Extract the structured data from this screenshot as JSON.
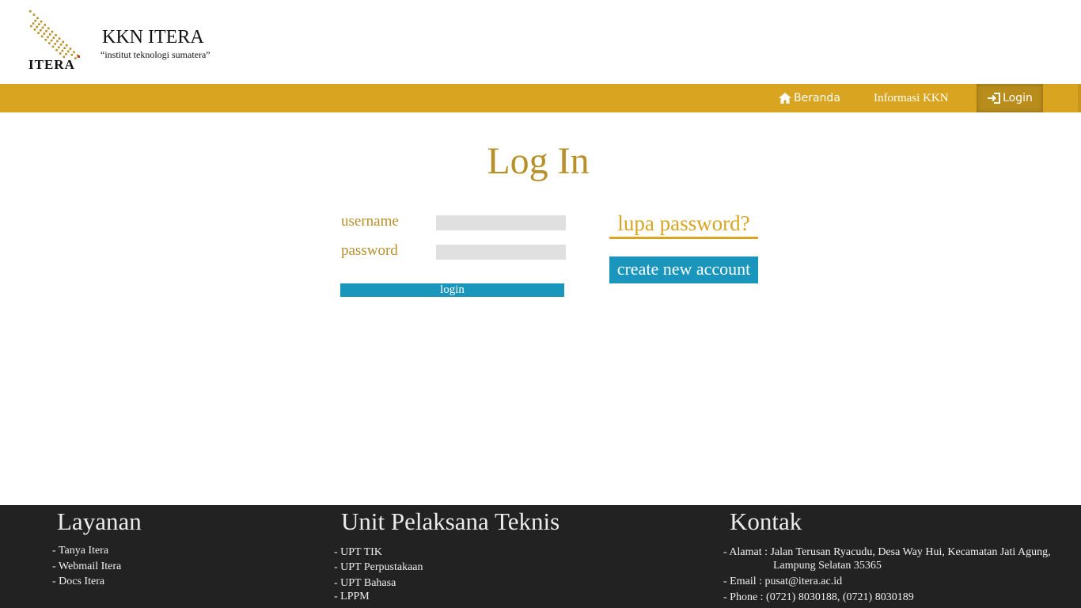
{
  "header": {
    "logo_text": "ITERA",
    "site_title": "KKN ITERA",
    "tagline": "“institut teknologi sumatera”"
  },
  "nav": {
    "items": [
      {
        "label": "Beranda",
        "icon": "home-icon"
      },
      {
        "label": "Informasi KKN"
      },
      {
        "label": "Login",
        "icon": "sign-in-icon",
        "active": true
      }
    ]
  },
  "main": {
    "title": "Log In",
    "username_label": "username",
    "password_label": "password",
    "username_value": "",
    "password_value": "",
    "login_button": "login",
    "forgot_password": "lupa password?",
    "create_account": "create new account"
  },
  "footer": {
    "layanan": {
      "heading": "Layanan",
      "items": [
        "- Tanya Itera",
        "- Webmail Itera",
        "- Docs Itera"
      ]
    },
    "upt": {
      "heading": "Unit Pelaksana Teknis",
      "items": [
        "- UPT TIK",
        "- UPT Perpustakaan",
        "- UPT Bahasa",
        "- LPPM"
      ]
    },
    "kontak": {
      "heading": "Kontak",
      "alamat_line1": "- Alamat : Jalan Terusan Ryacudu, Desa Way Hui, Kecamatan Jati Agung,",
      "alamat_line2": "Lampung Selatan 35365",
      "email": "- Email : pusat@itera.ac.id",
      "phone": "- Phone : (0721) 8030188, (0721) 8030189"
    }
  },
  "colors": {
    "gold": "#d9a521",
    "gold_text": "#b8902a",
    "blue": "#1a96bd",
    "footer_bg": "#222222"
  }
}
